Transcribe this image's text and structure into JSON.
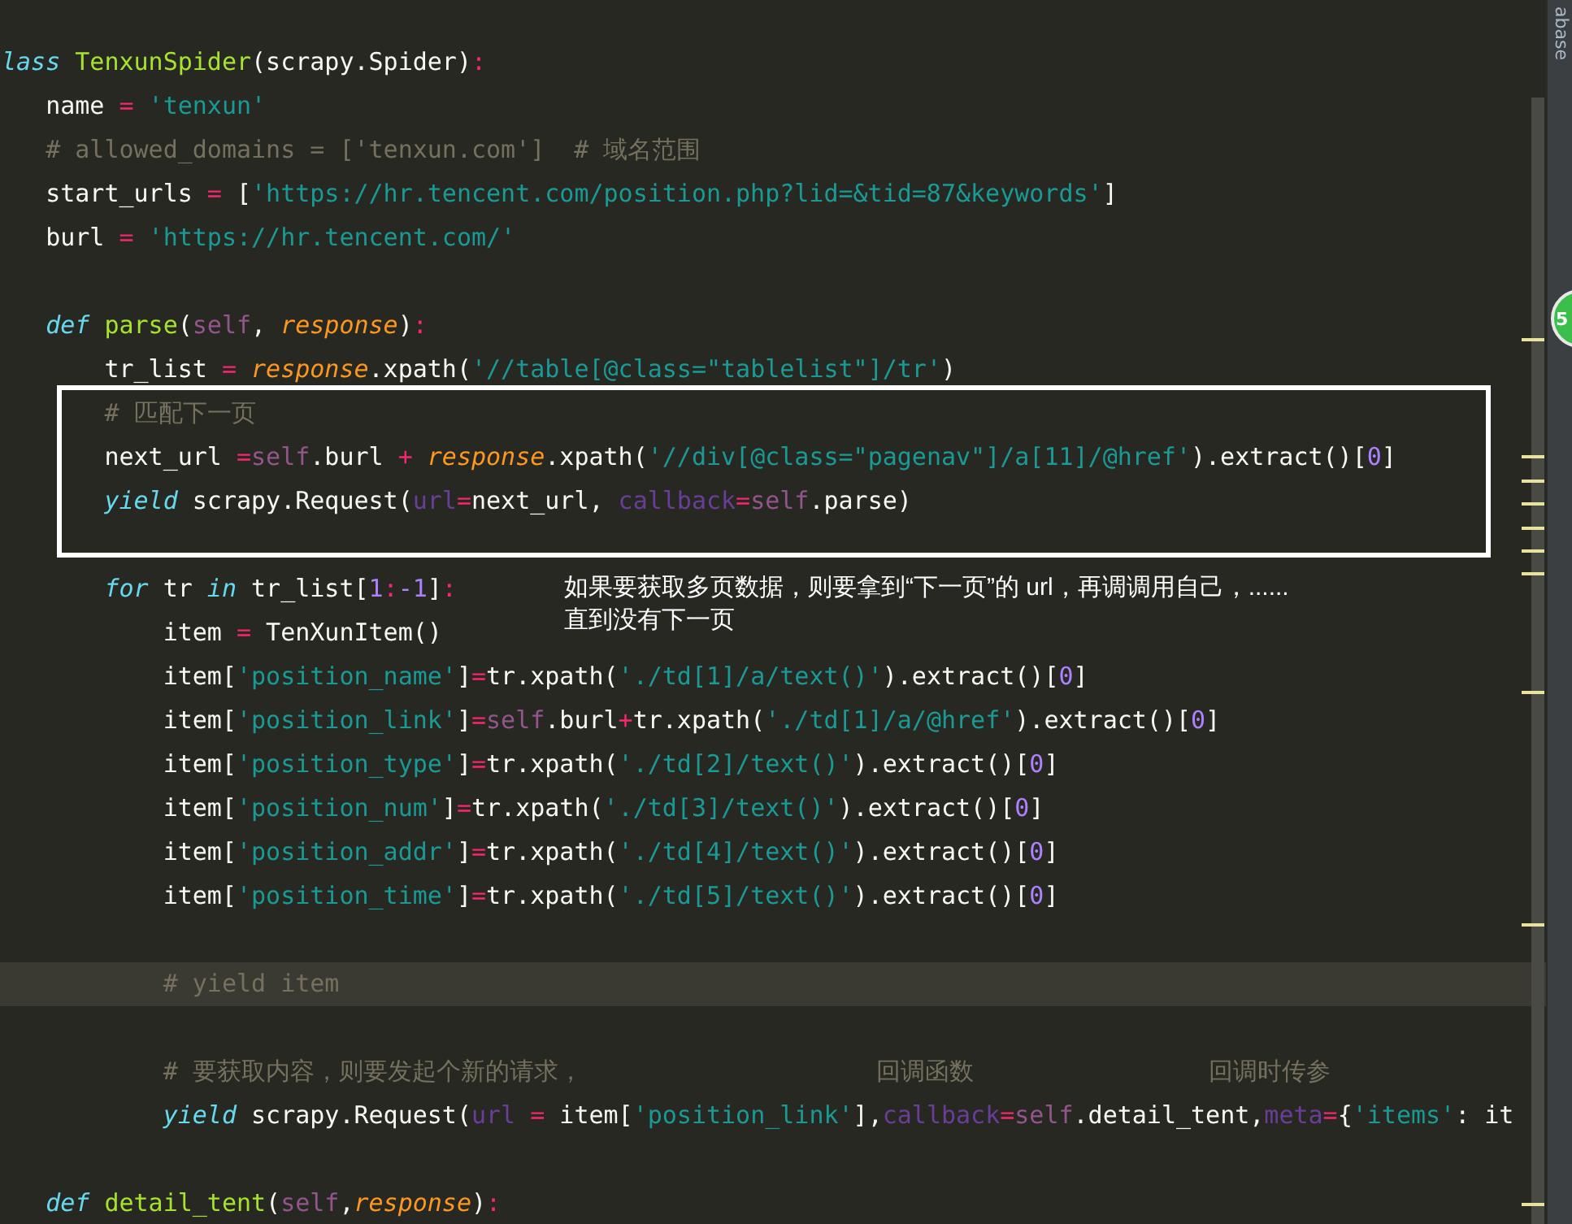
{
  "editor": {
    "lines": [
      {
        "highlighted": false,
        "tokens": [
          {
            "kind": "kw",
            "text": "lass"
          },
          {
            "kind": "cls",
            "text": " TenxunSpider"
          },
          {
            "kind": "txt",
            "text": "(scrapy.Spider)"
          },
          {
            "kind": "op",
            "text": ":"
          }
        ],
        "children": [
          {
            "highlighted": false,
            "tokens": [
              {
                "kind": "txt",
                "text": "name "
              },
              {
                "kind": "op",
                "text": "="
              },
              {
                "kind": "str",
                "text": " 'tenxun'"
              }
            ]
          },
          {
            "highlighted": false,
            "tokens": [
              {
                "kind": "cmt",
                "text": "# allowed_domains = ['tenxun.com']  # 域名范围"
              }
            ]
          },
          {
            "highlighted": false,
            "tokens": [
              {
                "kind": "txt",
                "text": "start_urls "
              },
              {
                "kind": "op",
                "text": "="
              },
              {
                "kind": "txt",
                "text": " ["
              },
              {
                "kind": "str",
                "text": "'https://hr.tencent.com/position.php?lid=&tid=87&keywords'"
              },
              {
                "kind": "txt",
                "text": "]"
              }
            ]
          },
          {
            "highlighted": false,
            "tokens": [
              {
                "kind": "txt",
                "text": "burl "
              },
              {
                "kind": "op",
                "text": "="
              },
              {
                "kind": "str",
                "text": " 'https://hr.tencent.com/'"
              }
            ]
          },
          {
            "highlighted": false
          },
          {
            "highlighted": false,
            "tokens": [
              {
                "kind": "kw",
                "text": "def"
              },
              {
                "kind": "fn",
                "text": " parse"
              },
              {
                "kind": "txt",
                "text": "("
              },
              {
                "kind": "self",
                "text": "self"
              },
              {
                "kind": "txt",
                "text": ","
              },
              {
                "kind": "param",
                "text": " response"
              },
              {
                "kind": "txt",
                "text": ")"
              },
              {
                "kind": "op",
                "text": ":"
              }
            ],
            "children": [
              {
                "highlighted": false,
                "tokens": [
                  {
                    "kind": "txt",
                    "text": "tr_list "
                  },
                  {
                    "kind": "op",
                    "text": "="
                  },
                  {
                    "kind": "param",
                    "text": " response"
                  },
                  {
                    "kind": "txt",
                    "text": ".xpath("
                  },
                  {
                    "kind": "str",
                    "text": "'//table[@class=\"tablelist\"]/tr'"
                  },
                  {
                    "kind": "txt",
                    "text": ")"
                  }
                ]
              },
              {
                "highlighted": false,
                "tokens": [
                  {
                    "kind": "cmt",
                    "text": "# 匹配下一页"
                  }
                ]
              },
              {
                "highlighted": false,
                "tokens": [
                  {
                    "kind": "txt",
                    "text": "next_url "
                  },
                  {
                    "kind": "op",
                    "text": "="
                  },
                  {
                    "kind": "self",
                    "text": "self"
                  },
                  {
                    "kind": "txt",
                    "text": ".burl "
                  },
                  {
                    "kind": "op",
                    "text": "+"
                  },
                  {
                    "kind": "param",
                    "text": " response"
                  },
                  {
                    "kind": "txt",
                    "text": ".xpath("
                  },
                  {
                    "kind": "str",
                    "text": "'//div[@class=\"pagenav\"]/a[11]/@href'"
                  },
                  {
                    "kind": "txt",
                    "text": ").extract()["
                  },
                  {
                    "kind": "num",
                    "text": "0"
                  },
                  {
                    "kind": "txt",
                    "text": "]"
                  }
                ]
              },
              {
                "highlighted": false,
                "tokens": [
                  {
                    "kind": "kw",
                    "text": "yield"
                  },
                  {
                    "kind": "txt",
                    "text": " scrapy.Request("
                  },
                  {
                    "kind": "arg",
                    "text": "url"
                  },
                  {
                    "kind": "op",
                    "text": "="
                  },
                  {
                    "kind": "txt",
                    "text": "next_url, "
                  },
                  {
                    "kind": "arg",
                    "text": "callback"
                  },
                  {
                    "kind": "op",
                    "text": "="
                  },
                  {
                    "kind": "self",
                    "text": "self"
                  },
                  {
                    "kind": "txt",
                    "text": ".parse)"
                  }
                ]
              },
              {
                "highlighted": false
              },
              {
                "highlighted": false,
                "tokens": [
                  {
                    "kind": "kw",
                    "text": "for"
                  },
                  {
                    "kind": "txt",
                    "text": " tr "
                  },
                  {
                    "kind": "kw",
                    "text": "in"
                  },
                  {
                    "kind": "txt",
                    "text": " tr_list["
                  },
                  {
                    "kind": "num",
                    "text": "1"
                  },
                  {
                    "kind": "op",
                    "text": ":"
                  },
                  {
                    "kind": "num",
                    "text": "-1"
                  },
                  {
                    "kind": "txt",
                    "text": "]"
                  },
                  {
                    "kind": "op",
                    "text": ":"
                  }
                ],
                "children": [
                  {
                    "highlighted": false,
                    "tokens": [
                      {
                        "kind": "txt",
                        "text": "item "
                      },
                      {
                        "kind": "op",
                        "text": "="
                      },
                      {
                        "kind": "txt",
                        "text": " TenXunItem()"
                      }
                    ]
                  },
                  {
                    "highlighted": false,
                    "tokens": [
                      {
                        "kind": "txt",
                        "text": "item["
                      },
                      {
                        "kind": "str",
                        "text": "'position_name'"
                      },
                      {
                        "kind": "txt",
                        "text": "]"
                      },
                      {
                        "kind": "op",
                        "text": "="
                      },
                      {
                        "kind": "txt",
                        "text": "tr.xpath("
                      },
                      {
                        "kind": "str",
                        "text": "'./td[1]/a/text()'"
                      },
                      {
                        "kind": "txt",
                        "text": ").extract()["
                      },
                      {
                        "kind": "num",
                        "text": "0"
                      },
                      {
                        "kind": "txt",
                        "text": "]"
                      }
                    ]
                  },
                  {
                    "highlighted": false,
                    "tokens": [
                      {
                        "kind": "txt",
                        "text": "item["
                      },
                      {
                        "kind": "str",
                        "text": "'position_link'"
                      },
                      {
                        "kind": "txt",
                        "text": "]"
                      },
                      {
                        "kind": "op",
                        "text": "="
                      },
                      {
                        "kind": "self",
                        "text": "self"
                      },
                      {
                        "kind": "txt",
                        "text": ".burl"
                      },
                      {
                        "kind": "op",
                        "text": "+"
                      },
                      {
                        "kind": "txt",
                        "text": "tr.xpath("
                      },
                      {
                        "kind": "str",
                        "text": "'./td[1]/a/@href'"
                      },
                      {
                        "kind": "txt",
                        "text": ").extract()["
                      },
                      {
                        "kind": "num",
                        "text": "0"
                      },
                      {
                        "kind": "txt",
                        "text": "]"
                      }
                    ]
                  },
                  {
                    "highlighted": false,
                    "tokens": [
                      {
                        "kind": "txt",
                        "text": "item["
                      },
                      {
                        "kind": "str",
                        "text": "'position_type'"
                      },
                      {
                        "kind": "txt",
                        "text": "]"
                      },
                      {
                        "kind": "op",
                        "text": "="
                      },
                      {
                        "kind": "txt",
                        "text": "tr.xpath("
                      },
                      {
                        "kind": "str",
                        "text": "'./td[2]/text()'"
                      },
                      {
                        "kind": "txt",
                        "text": ").extract()["
                      },
                      {
                        "kind": "num",
                        "text": "0"
                      },
                      {
                        "kind": "txt",
                        "text": "]"
                      }
                    ]
                  },
                  {
                    "highlighted": false,
                    "tokens": [
                      {
                        "kind": "txt",
                        "text": "item["
                      },
                      {
                        "kind": "str",
                        "text": "'position_num'"
                      },
                      {
                        "kind": "txt",
                        "text": "]"
                      },
                      {
                        "kind": "op",
                        "text": "="
                      },
                      {
                        "kind": "txt",
                        "text": "tr.xpath("
                      },
                      {
                        "kind": "str",
                        "text": "'./td[3]/text()'"
                      },
                      {
                        "kind": "txt",
                        "text": ").extract()["
                      },
                      {
                        "kind": "num",
                        "text": "0"
                      },
                      {
                        "kind": "txt",
                        "text": "]"
                      }
                    ]
                  },
                  {
                    "highlighted": false,
                    "tokens": [
                      {
                        "kind": "txt",
                        "text": "item["
                      },
                      {
                        "kind": "str",
                        "text": "'position_addr'"
                      },
                      {
                        "kind": "txt",
                        "text": "]"
                      },
                      {
                        "kind": "op",
                        "text": "="
                      },
                      {
                        "kind": "txt",
                        "text": "tr.xpath("
                      },
                      {
                        "kind": "str",
                        "text": "'./td[4]/text()'"
                      },
                      {
                        "kind": "txt",
                        "text": ").extract()["
                      },
                      {
                        "kind": "num",
                        "text": "0"
                      },
                      {
                        "kind": "txt",
                        "text": "]"
                      }
                    ]
                  },
                  {
                    "highlighted": false,
                    "tokens": [
                      {
                        "kind": "txt",
                        "text": "item["
                      },
                      {
                        "kind": "str",
                        "text": "'position_time'"
                      },
                      {
                        "kind": "txt",
                        "text": "]"
                      },
                      {
                        "kind": "op",
                        "text": "="
                      },
                      {
                        "kind": "txt",
                        "text": "tr.xpath("
                      },
                      {
                        "kind": "str",
                        "text": "'./td[5]/text()'"
                      },
                      {
                        "kind": "txt",
                        "text": ").extract()["
                      },
                      {
                        "kind": "num",
                        "text": "0"
                      },
                      {
                        "kind": "txt",
                        "text": "]"
                      }
                    ]
                  },
                  {
                    "highlighted": false
                  },
                  {
                    "highlighted": true,
                    "tokens": [
                      {
                        "kind": "cmt",
                        "text": "# yield item"
                      }
                    ]
                  },
                  {
                    "highlighted": false
                  },
                  {
                    "highlighted": false,
                    "tokens": [
                      {
                        "kind": "cmt",
                        "text": "# 要获取内容，则要发起个新的请求，                    回调函数                回调时传参"
                      }
                    ]
                  },
                  {
                    "highlighted": false,
                    "tokens": [
                      {
                        "kind": "kw",
                        "text": "yield"
                      },
                      {
                        "kind": "txt",
                        "text": " scrapy.Request("
                      },
                      {
                        "kind": "arg",
                        "text": "url"
                      },
                      {
                        "kind": "op",
                        "text": " ="
                      },
                      {
                        "kind": "txt",
                        "text": " item["
                      },
                      {
                        "kind": "str",
                        "text": "'position_link'"
                      },
                      {
                        "kind": "txt",
                        "text": "],"
                      },
                      {
                        "kind": "arg",
                        "text": "callback"
                      },
                      {
                        "kind": "op",
                        "text": "="
                      },
                      {
                        "kind": "self",
                        "text": "self"
                      },
                      {
                        "kind": "txt",
                        "text": ".detail_tent,"
                      },
                      {
                        "kind": "arg",
                        "text": "meta"
                      },
                      {
                        "kind": "op",
                        "text": "="
                      },
                      {
                        "kind": "txt",
                        "text": "{"
                      },
                      {
                        "kind": "str",
                        "text": "'items'"
                      },
                      {
                        "kind": "txt",
                        "text": ": it"
                      }
                    ]
                  }
                ]
              }
            ]
          },
          {
            "highlighted": false
          },
          {
            "highlighted": false,
            "tokens": [
              {
                "kind": "kw",
                "text": "def"
              },
              {
                "kind": "fn",
                "text": " detail_tent"
              },
              {
                "kind": "txt",
                "text": "("
              },
              {
                "kind": "self",
                "text": "self"
              },
              {
                "kind": "txt",
                "text": ","
              },
              {
                "kind": "param",
                "text": "response"
              },
              {
                "kind": "txt",
                "text": ")"
              },
              {
                "kind": "op",
                "text": ":"
              }
            ]
          }
        ]
      }
    ]
  },
  "annotation": {
    "lines": [
      "如果要获取多页数据，则要拿到“下一页”的 url，再调调用自己，......",
      "直到没有下一页"
    ]
  },
  "tool_strip": {
    "label": "abase"
  },
  "badge": {
    "text": "5"
  }
}
